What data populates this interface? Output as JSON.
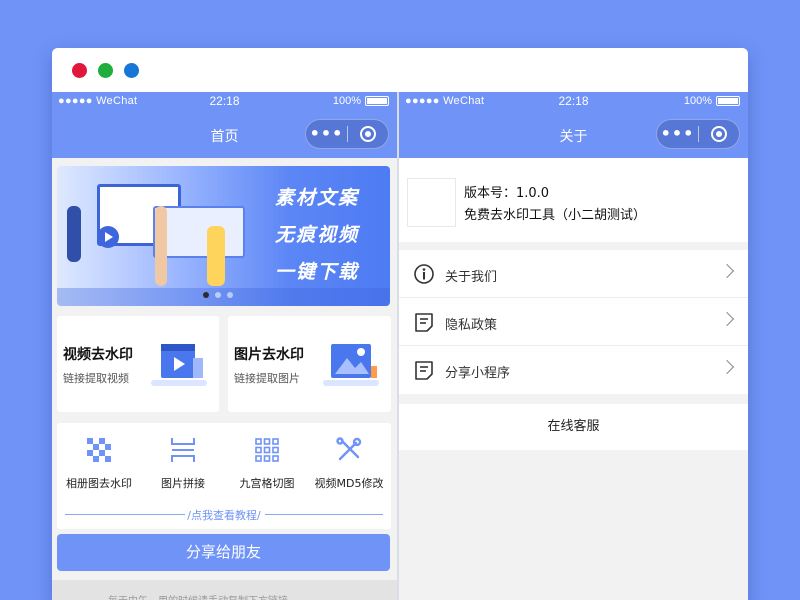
{
  "window": {
    "controls": [
      "close",
      "minimize",
      "maximize"
    ],
    "colors": {
      "close": "#e2173c",
      "minimize": "#1fae3e",
      "maximize": "#1776d6"
    }
  },
  "status_bar": {
    "carrier": "●●●●● WeChat",
    "time": "22:18",
    "battery": "100%"
  },
  "home": {
    "nav_title": "首页",
    "capsule_more": "•••",
    "banner": {
      "slogan_lines": [
        "素材文案",
        "无痕视频",
        "一键下载"
      ],
      "active_dot": 0,
      "dot_count": 3
    },
    "feature_cards": [
      {
        "title": "视频去水印",
        "subtitle": "链接提取视频"
      },
      {
        "title": "图片去水印",
        "subtitle": "链接提取图片"
      }
    ],
    "tools": [
      {
        "label": "相册图去水印",
        "icon": "mosaic-icon"
      },
      {
        "label": "图片拼接",
        "icon": "image-stitch-icon"
      },
      {
        "label": "九宫格切图",
        "icon": "grid-icon"
      },
      {
        "label": "视频MD5修改",
        "icon": "tools-icon"
      }
    ],
    "tutorial_link": "/点我查看教程/",
    "share_button": "分享给朋友",
    "footer_text": "每天中午，用的时候请手动复制下方链接"
  },
  "about": {
    "nav_title": "关于",
    "version": "版本号：1.0.0",
    "app_desc": "免费去水印工具（小二胡测试）",
    "menu": [
      {
        "label": "关于我们",
        "icon": "info-icon"
      },
      {
        "label": "隐私政策",
        "icon": "document-icon"
      },
      {
        "label": "分享小程序",
        "icon": "share-doc-icon"
      }
    ],
    "customer_service": "在线客服"
  },
  "colors": {
    "accent": "#6f93f7",
    "background": "#6f93f7"
  }
}
